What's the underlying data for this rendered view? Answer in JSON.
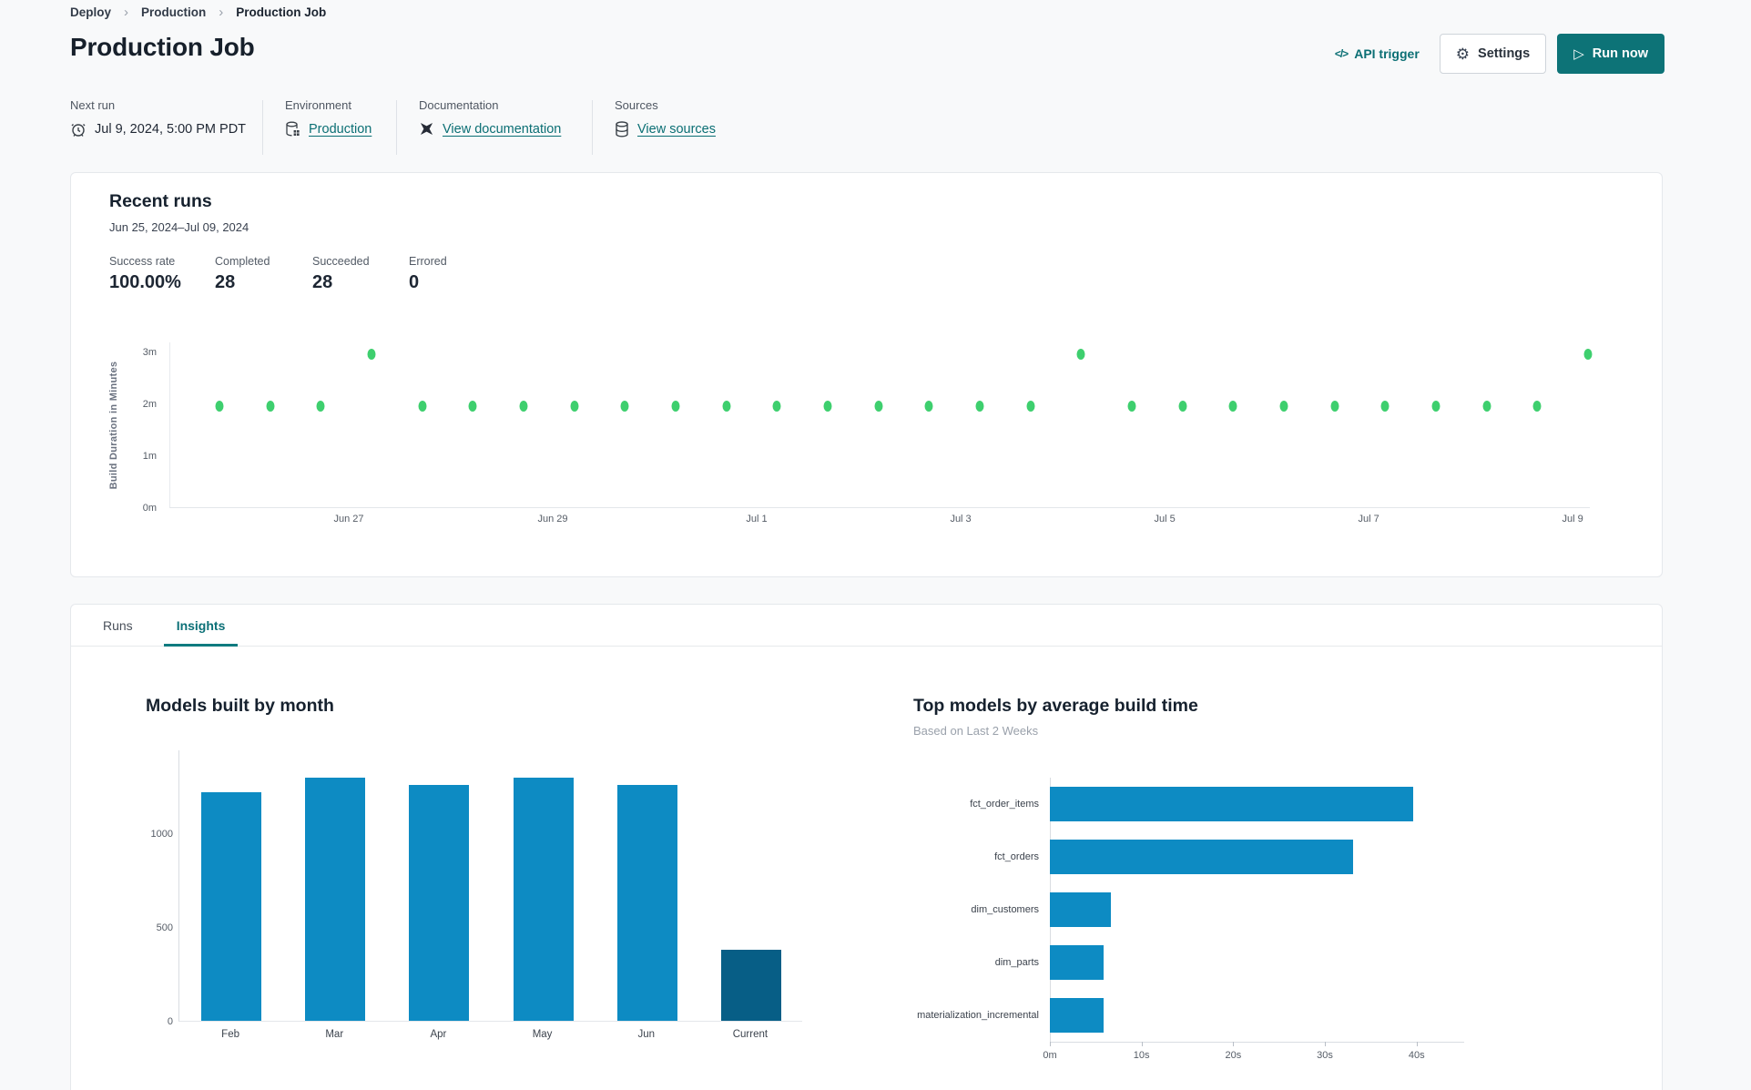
{
  "breadcrumb": {
    "items": [
      "Deploy",
      "Production",
      "Production Job"
    ]
  },
  "header": {
    "title": "Production Job",
    "api_trigger_label": "API trigger",
    "settings_label": "Settings",
    "run_now_label": "Run now"
  },
  "info": {
    "next_run": {
      "label": "Next run",
      "value": "Jul 9, 2024, 5:00 PM PDT"
    },
    "environment": {
      "label": "Environment",
      "value": "Production"
    },
    "documentation": {
      "label": "Documentation",
      "value": "View documentation"
    },
    "sources": {
      "label": "Sources",
      "value": "View sources"
    }
  },
  "recent_runs": {
    "title": "Recent runs",
    "date_range": "Jun 25, 2024–Jul 09, 2024",
    "stats": [
      {
        "label": "Success rate",
        "value": "100.00%"
      },
      {
        "label": "Completed",
        "value": "28"
      },
      {
        "label": "Succeeded",
        "value": "28"
      },
      {
        "label": "Errored",
        "value": "0"
      }
    ]
  },
  "tabs": [
    {
      "label": "Runs",
      "active": false
    },
    {
      "label": "Insights",
      "active": true
    }
  ],
  "colors": {
    "accent_teal": "#0d7377",
    "link_teal": "#0b6f74",
    "dot_green": "#3ecf6e",
    "bar_blue": "#0d8bc3",
    "bar_dark": "#075e86"
  },
  "chart_data": [
    {
      "type": "scatter",
      "title": "Recent runs build duration",
      "ylabel": "Build Duration in Minutes",
      "y_ticks": [
        "0m",
        "1m",
        "2m",
        "3m"
      ],
      "y_tick_values": [
        0,
        1,
        2,
        3
      ],
      "ylim": [
        0,
        3.2
      ],
      "x_ticks": [
        "Jun 27",
        "Jun 29",
        "Jul 1",
        "Jul 3",
        "Jul 5",
        "Jul 7",
        "Jul 9"
      ],
      "points_minutes": [
        1.95,
        1.95,
        1.95,
        2.95,
        1.95,
        1.95,
        1.95,
        1.95,
        1.95,
        1.95,
        1.95,
        1.95,
        1.95,
        1.95,
        1.95,
        1.95,
        1.95,
        2.95,
        1.95,
        1.95,
        1.95,
        1.95,
        1.95,
        1.95,
        1.95,
        1.95,
        1.95,
        2.95
      ]
    },
    {
      "type": "bar",
      "title": "Models built by month",
      "categories": [
        "Feb",
        "Mar",
        "Apr",
        "May",
        "Jun",
        "Current"
      ],
      "values": [
        1220,
        1300,
        1260,
        1300,
        1260,
        380
      ],
      "y_ticks": [
        0,
        500,
        1000
      ],
      "ylim": [
        0,
        1450
      ],
      "bar_colors": [
        "#0d8bc3",
        "#0d8bc3",
        "#0d8bc3",
        "#0d8bc3",
        "#0d8bc3",
        "#075e86"
      ]
    },
    {
      "type": "bar-horizontal",
      "title": "Top models by average build time",
      "subtitle": "Based on Last 2 Weeks",
      "categories": [
        "fct_order_items",
        "fct_orders",
        "dim_customers",
        "dim_parts",
        "materialization_incremental"
      ],
      "values_seconds": [
        39.6,
        33.1,
        6.7,
        5.9,
        5.9
      ],
      "x_ticks": [
        "0m",
        "10s",
        "20s",
        "30s",
        "40s"
      ],
      "x_tick_values": [
        0,
        10,
        20,
        30,
        40
      ],
      "xlim": [
        0,
        44
      ]
    }
  ]
}
